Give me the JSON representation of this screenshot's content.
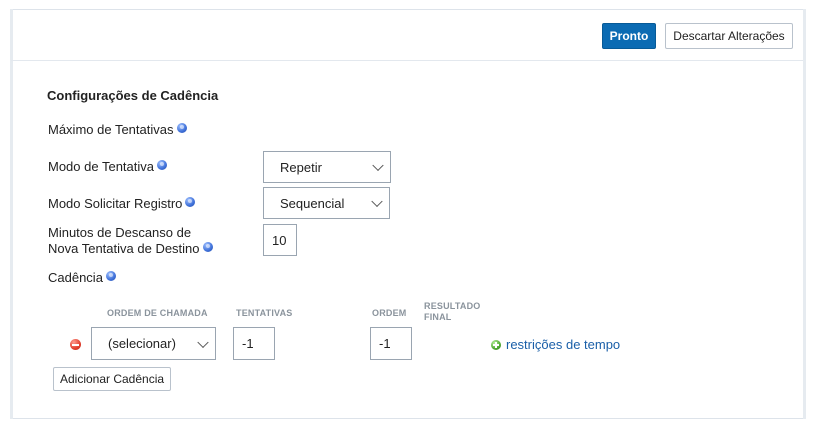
{
  "toolbar": {
    "done_label": "Pronto",
    "discard_label": "Descartar Alterações"
  },
  "section": {
    "title": "Configurações de Cadência"
  },
  "fields": {
    "max_attempts": {
      "label": "Máximo de Tentativas"
    },
    "attempt_mode": {
      "label": "Modo de Tentativa",
      "value": "Repetir"
    },
    "record_mode": {
      "label": "Modo Solicitar Registro",
      "value": "Sequencial"
    },
    "rest_minutes": {
      "label_line1": "Minutos de Descanso de",
      "label_line2": "Nova Tentativa de Destino",
      "value": "10"
    },
    "cadence": {
      "label": "Cadência"
    }
  },
  "cadence_table": {
    "headers": {
      "call_order": "ORDEM DE CHAMADA",
      "attempts": "TENTATIVAS",
      "order": "ORDEM",
      "final_result_line1": "RESULTADO",
      "final_result_line2": "FINAL"
    },
    "rows": [
      {
        "call_order": "(selecionar)",
        "attempts": "-1",
        "order": "-1",
        "time_restrictions_label": "restrições de tempo"
      }
    ],
    "add_label": "Adicionar Cadência"
  },
  "icons": {
    "help": "help-icon",
    "remove": "remove-icon",
    "add": "add-icon",
    "chevron": "chevron-down-icon"
  },
  "colors": {
    "primary": "#0b6bb3",
    "link": "#1a5fa8",
    "remove": "#e2402f",
    "add": "#4ea831",
    "help": "#3d6fd8"
  }
}
